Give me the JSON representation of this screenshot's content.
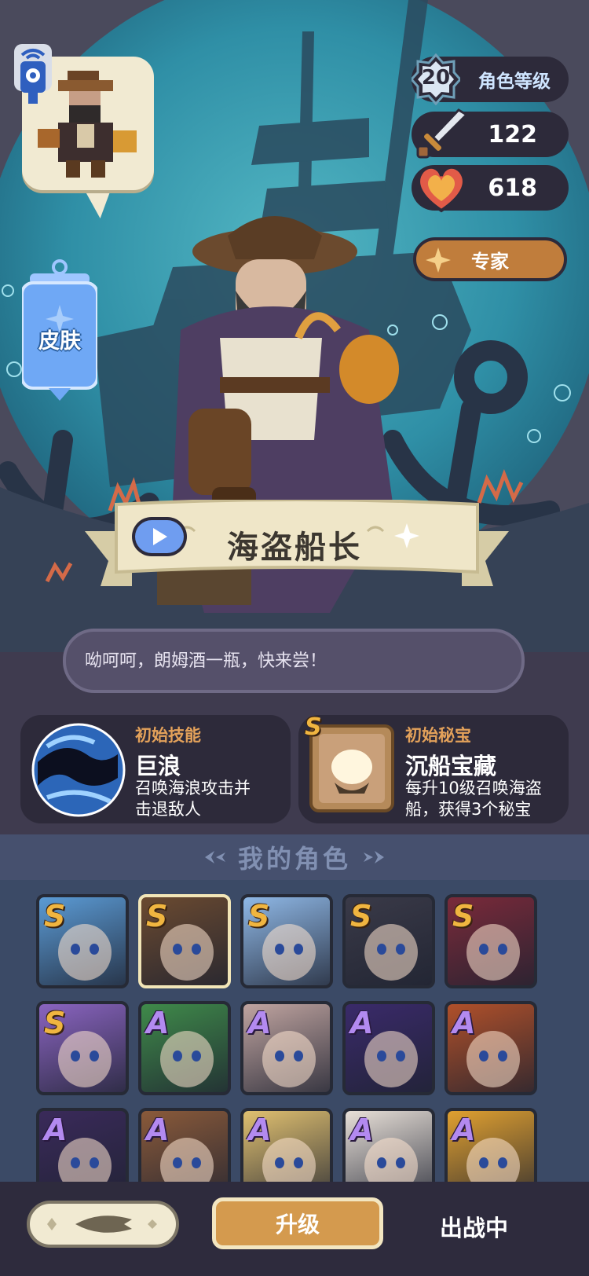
{
  "character": {
    "level": "20",
    "level_label": "角色等级",
    "attack": "122",
    "hp": "618",
    "rank_label": "专家",
    "skin_label": "皮肤",
    "name": "海盗船长",
    "quote": "呦呵呵，朗姆酒一瓶，快来尝！"
  },
  "skill": {
    "title": "初始技能",
    "name": "巨浪",
    "desc_line1": "召唤海浪攻击并",
    "desc_line2": "击退敌人"
  },
  "treasure": {
    "grade": "S",
    "title": "初始秘宝",
    "name": "沉船宝藏",
    "desc_line1": "每升10级召唤海盗",
    "desc_line2": "船，获得3个秘宝"
  },
  "roster": {
    "title": "我的角色",
    "heroes": [
      {
        "grade": "S"
      },
      {
        "grade": "S"
      },
      {
        "grade": "S"
      },
      {
        "grade": "S"
      },
      {
        "grade": "S"
      },
      {
        "grade": "S"
      },
      {
        "grade": "A"
      },
      {
        "grade": "A"
      },
      {
        "grade": "A"
      },
      {
        "grade": "A"
      },
      {
        "grade": "A"
      },
      {
        "grade": "A"
      },
      {
        "grade": "A"
      },
      {
        "grade": "A"
      },
      {
        "grade": "A"
      }
    ]
  },
  "footer": {
    "upgrade_label": "升级",
    "deployed_label": "出战中"
  },
  "colors": {
    "sea": "#2f8fa6",
    "panel": "#2d2a3a",
    "gold": "#e3a15a",
    "s_grade": "#f0b540",
    "a_grade": "#b38af0"
  }
}
